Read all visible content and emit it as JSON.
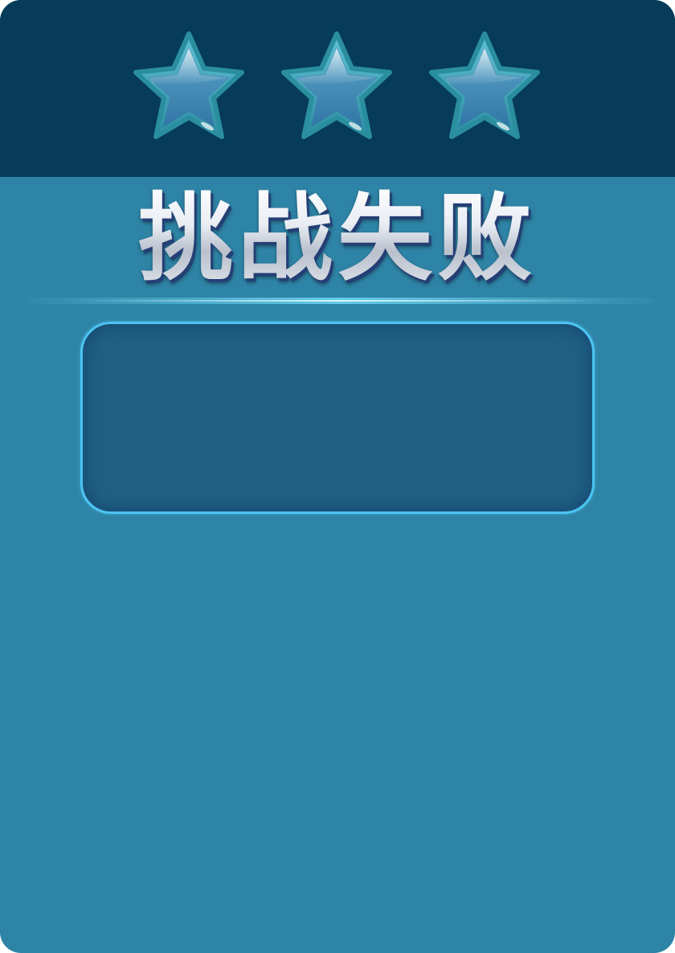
{
  "result": {
    "title": "挑战失败",
    "stars_earned": 0,
    "stars_total": 3
  },
  "stars": [
    {
      "icon": "star-icon",
      "state": "empty"
    },
    {
      "icon": "star-icon",
      "state": "empty"
    },
    {
      "icon": "star-icon",
      "state": "empty"
    }
  ],
  "info_box": {
    "text": ""
  },
  "colors": {
    "panel": "#2e84a6",
    "header": "#063b59",
    "box_fill": "#215f84",
    "box_border": "#4cc4f2",
    "star_fill": "#3f86b2",
    "star_rim": "#3aa6b8"
  }
}
